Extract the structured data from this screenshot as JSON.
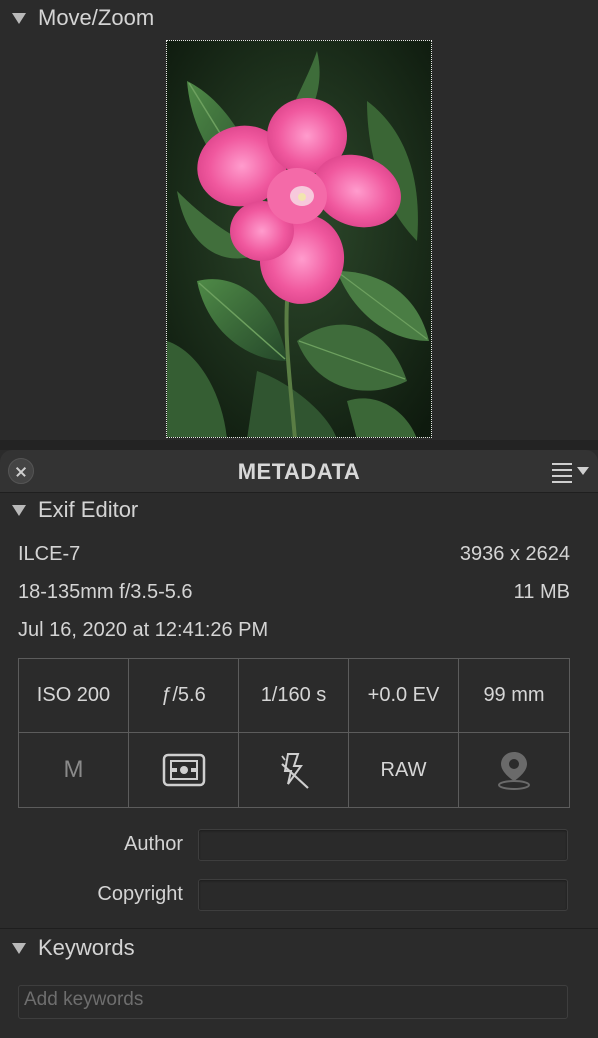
{
  "move_zoom": {
    "title": "Move/Zoom"
  },
  "metadata_panel": {
    "title": "METADATA"
  },
  "exif_editor": {
    "title": "Exif Editor",
    "camera": "ILCE-7",
    "dimensions": "3936 x 2624",
    "lens": "18-135mm f/3.5-5.6",
    "file_size": "11 MB",
    "date": "Jul 16, 2020 at 12:41:26 PM",
    "grid": {
      "iso": "ISO 200",
      "aperture": "ƒ/5.6",
      "shutter": "1/160 s",
      "exposure_comp": "+0.0 EV",
      "focal_length": "99 mm",
      "mode": "M",
      "metering_icon": "metering-icon",
      "flash_icon": "flash-off-icon",
      "format": "RAW",
      "location_icon": "location-pin-icon"
    },
    "author_label": "Author",
    "author_value": "",
    "copyright_label": "Copyright",
    "copyright_value": ""
  },
  "keywords": {
    "title": "Keywords",
    "placeholder": "Add keywords"
  },
  "colors": {
    "background": "#2b2b2b",
    "flower": "#f0589e",
    "leaf": "#3e6d3a"
  }
}
